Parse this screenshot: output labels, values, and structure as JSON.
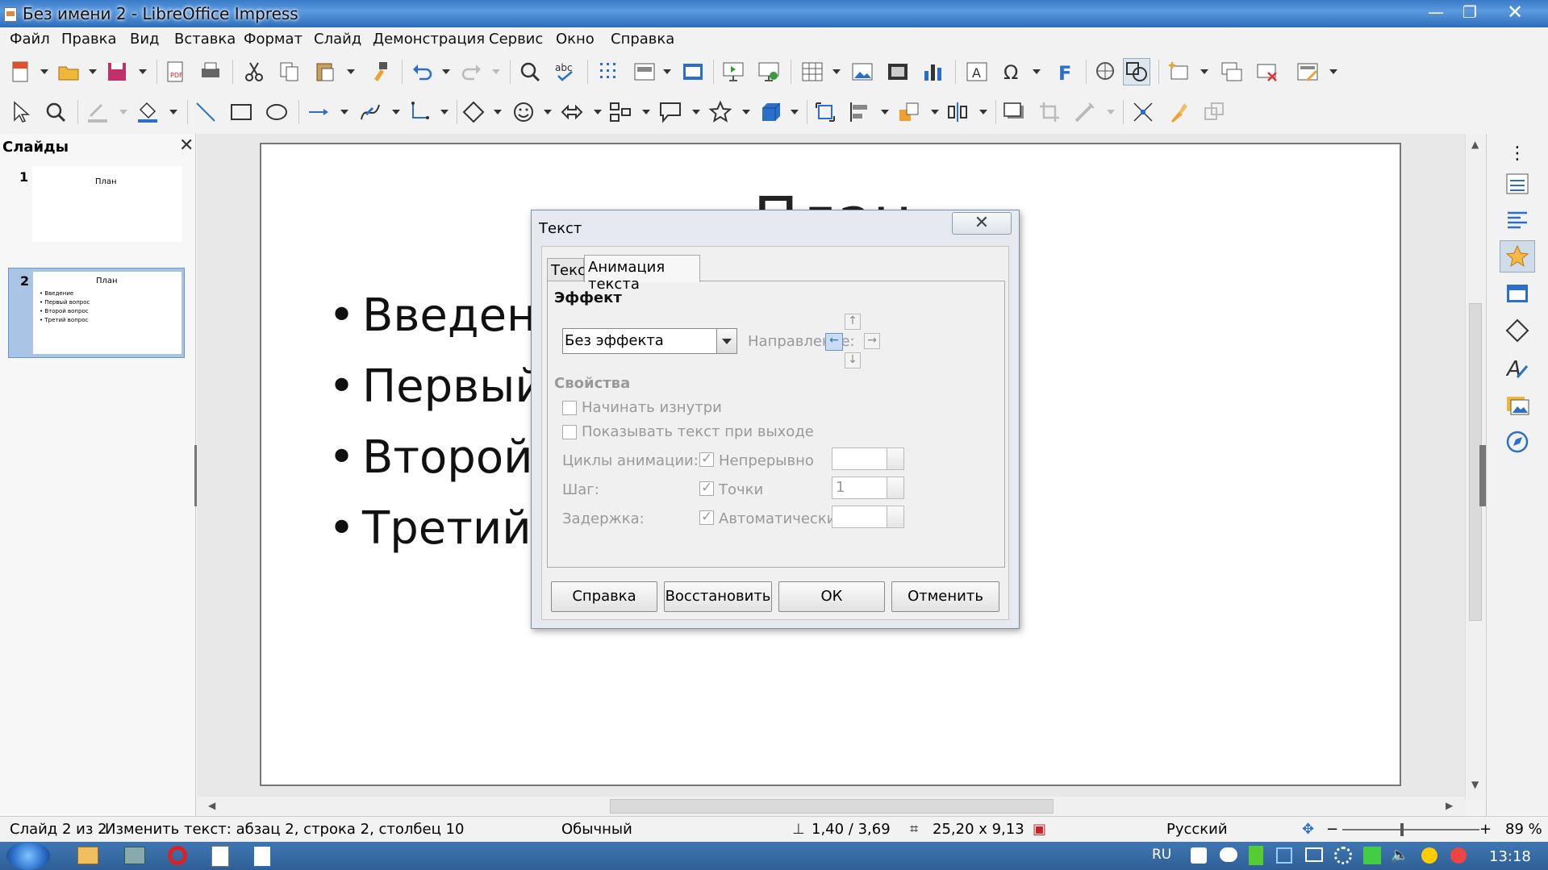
{
  "window": {
    "title": "Без имени 2 - LibreOffice Impress"
  },
  "menu": [
    "Файл",
    "Правка",
    "Вид",
    "Вставка",
    "Формат",
    "Слайд",
    "Демонстрация",
    "Сервис",
    "Окно",
    "Справка"
  ],
  "slides_panel": {
    "title": "Слайды",
    "slides": [
      {
        "number": "1",
        "title": "План",
        "bullets": []
      },
      {
        "number": "2",
        "title": "План",
        "bullets": [
          "Введение",
          "Первый вопрос",
          "Второй вопрос",
          "Третий вопрос"
        ]
      }
    ]
  },
  "slide": {
    "title": "План",
    "bullets": [
      "Введени",
      "Первый",
      "Второй",
      "Третий"
    ]
  },
  "dialog": {
    "title": "Текст",
    "tabs": [
      "Текст",
      "Анимация текста"
    ],
    "effect_section": "Эффект",
    "effect_value": "Без эффекта",
    "direction_label": "Направление:",
    "properties_section": "Свойства",
    "cb_start_inside": "Начинать изнутри",
    "cb_show_on_exit": "Показывать текст при выходе",
    "anim_cycles_label": "Циклы анимации:",
    "anim_cycles_cb": "Непрерывно",
    "step_label": "Шаг:",
    "step_cb": "Точки",
    "step_value": "1",
    "delay_label": "Задержка:",
    "delay_cb": "Автоматически",
    "buttons": {
      "help": "Справка",
      "reset": "Восстановить",
      "ok": "ОК",
      "cancel": "Отменить"
    }
  },
  "statusbar": {
    "slide": "Слайд 2 из 2",
    "action": "Изменить текст: абзац 2, строка 2, столбец 10",
    "layout": "Обычный",
    "position": "1,40 / 3,69",
    "size": "25,20 x 9,13",
    "language": "Русский",
    "zoom": "89 %"
  },
  "taskbar": {
    "lang": "RU",
    "time": "13:18"
  },
  "colors": {
    "titlebar": "#3a7bc8",
    "taskbar": "#2f5f96",
    "accent": "#1e6fd0"
  }
}
